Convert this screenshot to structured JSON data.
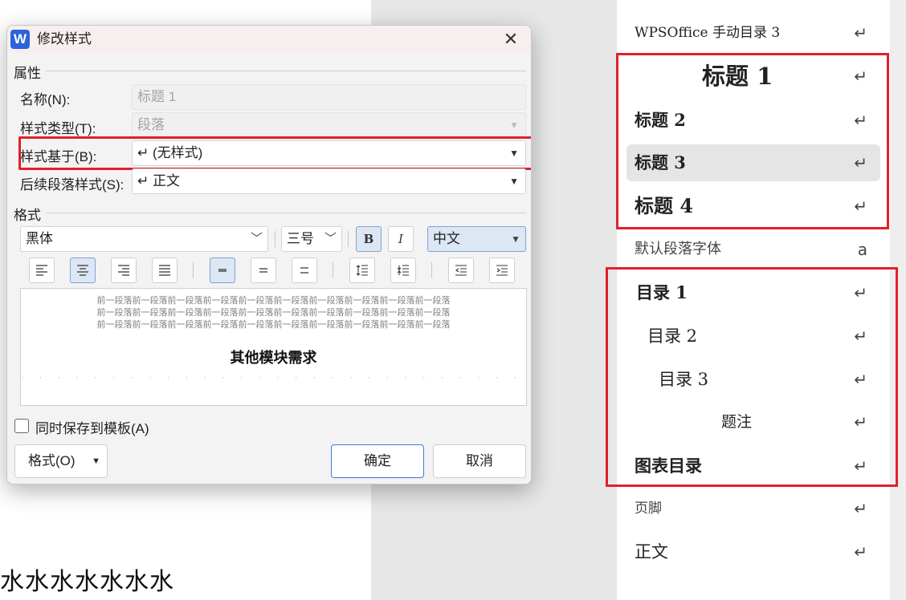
{
  "document": {
    "body_text": "水水水水水水水"
  },
  "dialog": {
    "app_logo": "W",
    "title": "修改样式",
    "close_label": "✕",
    "properties": {
      "header": "属性",
      "name_label": "名称(N):",
      "name_value": "标题 1",
      "style_type_label": "样式类型(T):",
      "style_type_value": "段落",
      "based_on_label": "样式基于(B):",
      "based_on_value": "↵ (无样式)",
      "next_style_label": "后续段落样式(S):",
      "next_style_value": "↵ 正文"
    },
    "format": {
      "header": "格式",
      "font": "黑体",
      "size": "三号",
      "bold_label": "B",
      "italic_label": "I",
      "script": "中文"
    },
    "preview": {
      "prev_lines": [
        "前一段落前一段落前一段落前一段落前一段落前一段落前一段落前一段落前一段落前一段落",
        "前一段落前一段落前一段落前一段落前一段落前一段落前一段落前一段落前一段落前一段落",
        "前一段落前一段落前一段落前一段落前一段落前一段落前一段落前一段落前一段落前一段落"
      ],
      "sample_text": "其他模块需求"
    },
    "save_to_template_label": "同时保存到模板(A)",
    "format_menu_label": "格式(O)",
    "ok_label": "确定",
    "cancel_label": "取消"
  },
  "style_pane": {
    "items": [
      {
        "name": "WPSOffice 手动目录 3",
        "mark": "↵"
      },
      {
        "name": "标题 1",
        "mark": "↵"
      },
      {
        "name": "标题 2",
        "mark": "↵"
      },
      {
        "name": "标题 3",
        "mark": "↵"
      },
      {
        "name": "标题 4",
        "mark": "↵"
      },
      {
        "name": "默认段落字体",
        "mark": "a"
      },
      {
        "name": "目录 1",
        "mark": "↵"
      },
      {
        "name": "目录 2",
        "mark": "↵"
      },
      {
        "name": "目录 3",
        "mark": "↵"
      },
      {
        "name": "题注",
        "mark": "↵"
      },
      {
        "name": "图表目录",
        "mark": "↵"
      },
      {
        "name": "页脚",
        "mark": "↵"
      },
      {
        "name": "正文",
        "mark": "↵"
      }
    ]
  },
  "colors": {
    "highlight_red": "#e0202b",
    "accent_blue": "#3f7bd6",
    "app_blue": "#2b63d9"
  },
  "icons": {
    "align": [
      "align-left-icon",
      "align-center-icon",
      "align-right-icon",
      "align-justify-icon"
    ],
    "spacing": [
      "single-spacing-icon",
      "one-half-spacing-icon",
      "double-spacing-icon",
      "spacing-increase-icon",
      "spacing-decrease-icon",
      "indent-decrease-icon",
      "indent-increase-icon"
    ]
  }
}
